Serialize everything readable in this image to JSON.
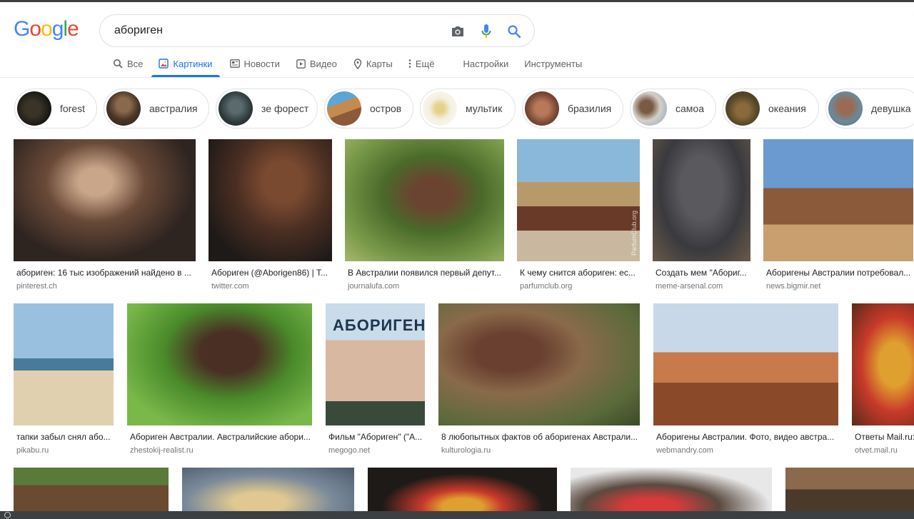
{
  "logo": {
    "letters": [
      "G",
      "o",
      "o",
      "g",
      "l",
      "e"
    ],
    "colors": [
      "#4285F4",
      "#EA4335",
      "#FBBC05",
      "#4285F4",
      "#34A853",
      "#EA4335"
    ]
  },
  "search": {
    "query": "абориген",
    "icons": [
      "camera-icon",
      "microphone-icon",
      "search-icon"
    ]
  },
  "tabs": [
    {
      "label": "Все",
      "icon": "search-icon",
      "active": false
    },
    {
      "label": "Картинки",
      "icon": "image-icon",
      "active": true
    },
    {
      "label": "Новости",
      "icon": "news-icon",
      "active": false
    },
    {
      "label": "Видео",
      "icon": "video-icon",
      "active": false
    },
    {
      "label": "Карты",
      "icon": "map-pin-icon",
      "active": false
    },
    {
      "label": "Ещё",
      "icon": "more-vert-icon",
      "active": false
    },
    {
      "label": "Настройки",
      "icon": "",
      "active": false
    },
    {
      "label": "Инструменты",
      "icon": "",
      "active": false
    }
  ],
  "chips": [
    {
      "label": "forest"
    },
    {
      "label": "австралия"
    },
    {
      "label": "зе форест"
    },
    {
      "label": "остров"
    },
    {
      "label": "мультик"
    },
    {
      "label": "бразилия"
    },
    {
      "label": "самоа"
    },
    {
      "label": "океания"
    },
    {
      "label": "девушка"
    }
  ],
  "results": {
    "row1": [
      {
        "caption": "абориген: 16 тыс изображений найдено в ...",
        "domain": "pinterest.ch"
      },
      {
        "caption": "Абориген (@Aborigen86) | Т...",
        "domain": "twitter.com"
      },
      {
        "caption": "В Австралии появился первый депут...",
        "domain": "journalufa.com"
      },
      {
        "caption": "К чему снится абориген: ес...",
        "domain": "parfumclub.org",
        "watermark": "ParfumClub.org"
      },
      {
        "caption": "Создать мем \"Абориг...",
        "domain": "meme-arsenal.com"
      },
      {
        "caption": "Аборигены Австралии потребовал...",
        "domain": "news.bigmir.net"
      }
    ],
    "row2": [
      {
        "caption": "тапки забыл снял або...",
        "domain": "pikabu.ru"
      },
      {
        "caption": "Абориген Австралии. Австралийские абори...",
        "domain": "zhestokij-realist.ru"
      },
      {
        "caption": "Фильм \"Абориген\" (\"А...",
        "domain": "megogo.net",
        "overlay": "АБОРИГЕН"
      },
      {
        "caption": "8 любопытных фактов об аборигенах Австрали...",
        "domain": "kulturologia.ru"
      },
      {
        "caption": "Аборигены Австралии. Фото, видео австра...",
        "domain": "webmandry.com"
      },
      {
        "caption": "Ответы Mail.ru:",
        "domain": "otvet.mail.ru"
      }
    ]
  }
}
